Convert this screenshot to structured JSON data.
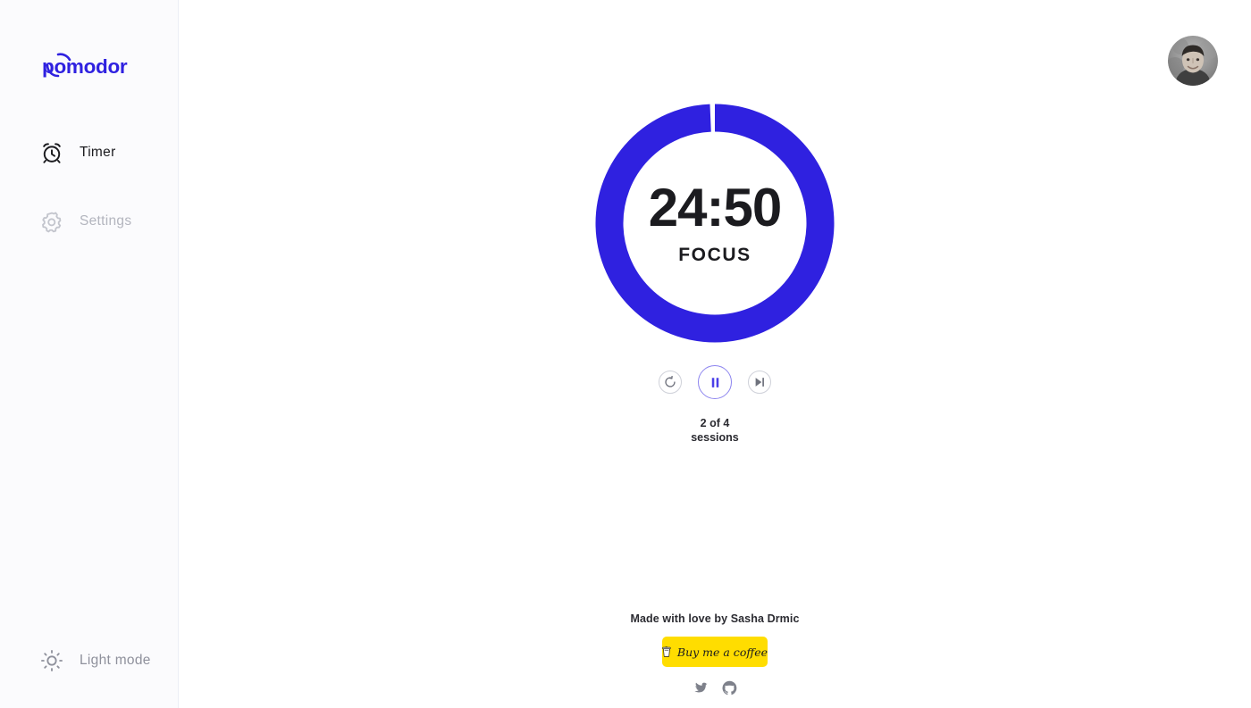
{
  "app": {
    "brand": "pomodor",
    "accent_color": "#2f21e0",
    "accent_light": "#8d85ef",
    "coffee_yellow": "#ffdd00",
    "text_color": "#1b1b1f",
    "muted_color": "#b3b5be"
  },
  "sidebar": {
    "items": [
      {
        "label": "Timer",
        "icon": "alarm-clock-icon",
        "state": "active"
      },
      {
        "label": "Settings",
        "icon": "gear-icon",
        "state": "inactive"
      }
    ],
    "mode_toggle": {
      "label": "Light mode",
      "icon": "sun-icon"
    }
  },
  "header": {
    "avatar": "user-avatar"
  },
  "timer": {
    "time": "24:50",
    "phase": "FOCUS",
    "progress_percent": 99.3,
    "sessions_current": "2 of 4",
    "sessions_label": "sessions",
    "controls": [
      {
        "name": "reset",
        "icon": "reset-icon"
      },
      {
        "name": "pause",
        "icon": "pause-icon"
      },
      {
        "name": "skip",
        "icon": "skip-forward-icon"
      }
    ]
  },
  "footer": {
    "credit": "Made with love by Sasha Drmic",
    "coffee_button": "Buy me a coffee",
    "coffee_icon": "coffee-cup-icon",
    "socials": [
      {
        "name": "twitter",
        "icon": "twitter-icon"
      },
      {
        "name": "github",
        "icon": "github-icon"
      }
    ]
  }
}
